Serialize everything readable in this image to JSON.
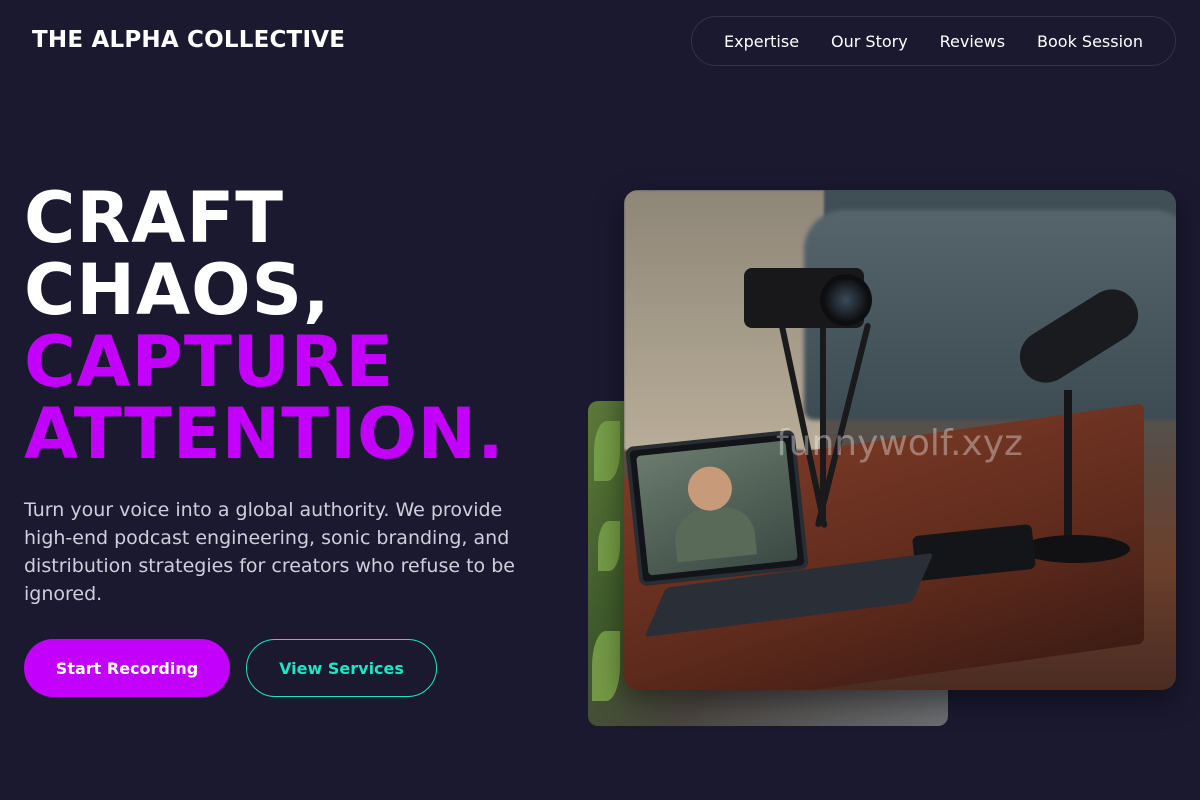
{
  "brand": "THE ALPHA COLLECTIVE",
  "nav": {
    "items": [
      "Expertise",
      "Our Story",
      "Reviews",
      "Book Session"
    ]
  },
  "hero": {
    "line1": "CRAFT",
    "line2": "CHAOS,",
    "line3": "CAPTURE",
    "line4": "ATTENTION.",
    "lead": "Turn your voice into a global authority. We provide high-end podcast engineering, sonic branding, and distribution strategies for creators who refuse to be ignored.",
    "primary_cta": "Start Recording",
    "secondary_cta": "View Services"
  },
  "watermark": "funnywolf.xyz",
  "colors": {
    "background": "#1b1930",
    "accent": "#c200fb",
    "teal": "#1ce6c3",
    "text": "#ffffff",
    "muted_text": "#cfcfdc"
  }
}
